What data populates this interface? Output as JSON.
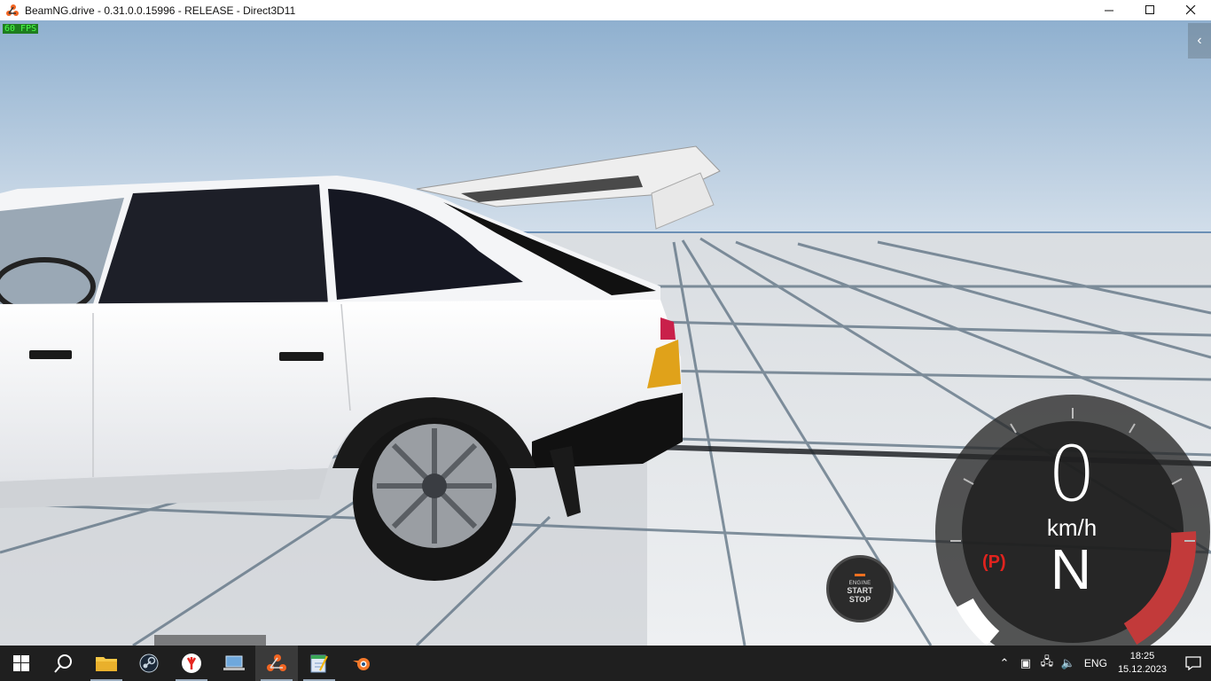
{
  "window": {
    "title": "BeamNG.drive - 0.31.0.0.15996 - RELEASE - Direct3D11"
  },
  "hud": {
    "fps": "60 FPS",
    "speed": "0",
    "speed_unit": "km/h",
    "gear": "N",
    "parking_brake": "(P)",
    "engine_button": {
      "line1": "ENGINE",
      "line2": "START",
      "line3": "STOP"
    }
  },
  "taskbar": {
    "apps": [
      "start-icon",
      "search-icon",
      "file-explorer-icon",
      "steam-icon",
      "yandex-browser-icon",
      "laptop-icon",
      "beamng-icon",
      "notepad-icon",
      "blender-icon"
    ],
    "language": "ENG",
    "time": "18:25",
    "date": "15.12.2023"
  },
  "colors": {
    "sky_top": "#8fb0cf",
    "sky_bottom": "#cfdceb",
    "ground": "#e6e8ea",
    "grid_line": "#5b6f80",
    "car_body": "#f2f3f5",
    "parking_red": "#e0231e",
    "taskbar": "#1f1f1f"
  }
}
